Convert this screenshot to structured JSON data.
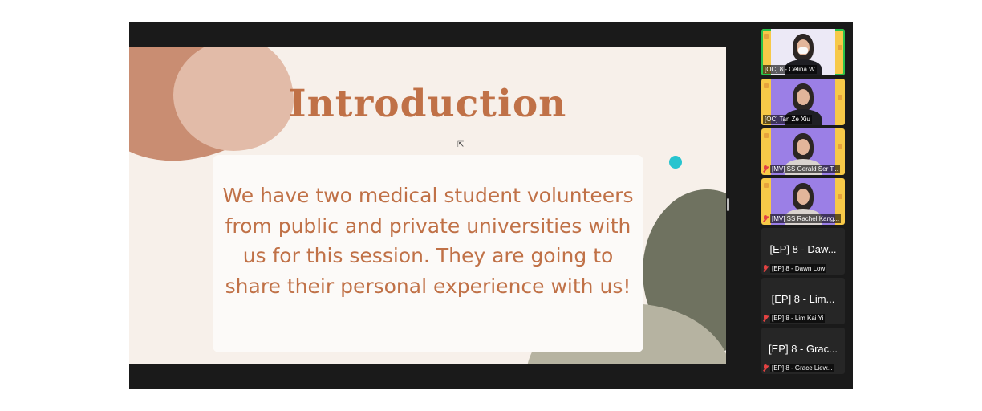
{
  "slide": {
    "title": "Introduction",
    "body": "We have two medical student volunteers from public and private universities with us for this session. They are going to share their personal experience with us!",
    "colors": {
      "text": "#c07147",
      "background": "#f7f0ea",
      "accent_dot": "#27c4cf"
    }
  },
  "participants": [
    {
      "label": "[OC] 8 - Celina W",
      "video": true,
      "active": true,
      "muted": false
    },
    {
      "label": "[OC] Tan Ze Xiu",
      "video": true,
      "active": false,
      "muted": false
    },
    {
      "label": "[MV] SS Gerald Ser T...",
      "video": true,
      "active": false,
      "muted": true
    },
    {
      "label": "[MV] SS Rachel Kang...",
      "video": true,
      "active": false,
      "muted": true
    },
    {
      "display_name": "[EP] 8 - Daw...",
      "label": "[EP] 8 - Dawn Low",
      "video": false,
      "muted": true
    },
    {
      "display_name": "[EP] 8 - Lim...",
      "label": "[EP] 8 - Lim Kai Yi",
      "video": false,
      "muted": true
    },
    {
      "display_name": "[EP] 8 - Grac...",
      "label": "[EP] 8 - Grace Liew...",
      "video": false,
      "muted": true
    }
  ],
  "icons": {
    "mute": "mic-muted-icon",
    "pointer": "mouse-pointer-icon"
  }
}
